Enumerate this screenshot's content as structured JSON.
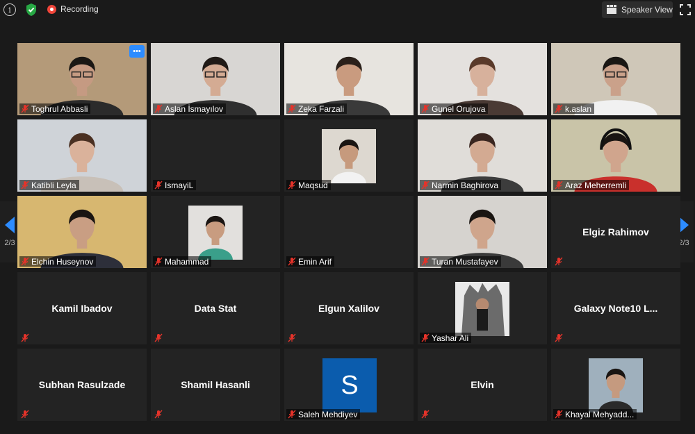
{
  "topbar": {
    "recording_label": "Recording",
    "speaker_view_label": "Speaker View"
  },
  "pagination": {
    "left_label": "2/3",
    "right_label": "2/3"
  },
  "tiles": [
    {
      "name": "Toghrul Abbasli",
      "video": true,
      "skin": "#c59a82",
      "shirt": "#2b2b2b",
      "bg": "#b49a79",
      "hair": "#1a1714",
      "glasses": true,
      "active_menu": true
    },
    {
      "name": "Aslan İsmayılov",
      "video": true,
      "skin": "#d4ab93",
      "shirt": "#2f2f2f",
      "bg": "#d8d6d3",
      "hair": "#201a16",
      "glasses": true
    },
    {
      "name": "Zeka Farzali",
      "video": true,
      "skin": "#c99b7f",
      "shirt": "#3a3a3a",
      "bg": "#e7e4df",
      "hair": "#2a201a"
    },
    {
      "name": "Gunel Orujova",
      "video": true,
      "skin": "#d7b19c",
      "shirt": "#4a3a34",
      "bg": "#e4e1de",
      "hair": "#5a3a2a"
    },
    {
      "name": "k.aslan",
      "video": true,
      "skin": "#caa18a",
      "shirt": "#f1f1f1",
      "bg": "#cfc7b8",
      "hair": "#1a1714",
      "glasses": true
    },
    {
      "name": "Katibli Leyla",
      "video": true,
      "skin": "#dab29b",
      "shirt": "#c8c0b8",
      "bg": "#cfd3d8",
      "hair": "#4a3022"
    },
    {
      "name": "IsmayiL",
      "video": false
    },
    {
      "name": "Maqsud",
      "video": true,
      "small": true,
      "skin": "#c69a7d",
      "shirt": "#f2f2f2",
      "bg": "#ddd8d0",
      "hair": "#1a1512"
    },
    {
      "name": "Narmin Baghirova",
      "video": true,
      "skin": "#d3aa92",
      "shirt": "#3c3c3c",
      "bg": "#e0ddd9",
      "hair": "#3a2620"
    },
    {
      "name": "Araz Meherremli",
      "video": true,
      "skin": "#d0a58d",
      "shirt": "#c9302c",
      "bg": "#c9c4a8",
      "hair": "#1a1512",
      "headset": true
    },
    {
      "name": "Elchin Huseynov",
      "video": true,
      "skin": "#c99e83",
      "shirt": "#2d2f3a",
      "bg": "#d7b770",
      "hair": "#1a1512"
    },
    {
      "name": "Mahammad",
      "video": true,
      "small": true,
      "skin": "#c89c80",
      "shirt": "#3a9f8a",
      "bg": "#e2e0dd",
      "hair": "#1a1512"
    },
    {
      "name": "Emin Arif",
      "video": false
    },
    {
      "name": "Turan Mustafayev",
      "video": true,
      "skin": "#cfa58c",
      "shirt": "#3a3a3a",
      "bg": "#d6d3cf",
      "hair": "#1a1512"
    },
    {
      "name": "Elgiz Rahimov",
      "video": false,
      "big": true
    },
    {
      "name": "Kamil Ibadov",
      "video": false,
      "big": true
    },
    {
      "name": "Data Stat",
      "video": false,
      "big": true
    },
    {
      "name": "Elgun Xalilov",
      "video": false,
      "big": true
    },
    {
      "name": "Yashar Ali",
      "video": true,
      "small": true,
      "throne": true,
      "skin": "#b68a70",
      "shirt": "#222",
      "bg": "#e9e9e9",
      "hair": "#1a1512"
    },
    {
      "name": "Galaxy Note10 L...",
      "video": false,
      "big": true
    },
    {
      "name": "Subhan Rasulzade",
      "video": false,
      "big": true
    },
    {
      "name": "Shamil Hasanli",
      "video": false,
      "big": true
    },
    {
      "name": "Saleh Mehdiyev",
      "video": false,
      "avatar": "S"
    },
    {
      "name": "Elvin",
      "video": false,
      "big": true
    },
    {
      "name": "Khayal Mehyadd...",
      "video": true,
      "small": true,
      "skin": "#c59a7f",
      "shirt": "#2a2a2a",
      "bg": "#9fb0bd",
      "hair": "#1a1512"
    }
  ],
  "colors": {
    "accent": "#2d8cff",
    "recording": "#f0453a",
    "mute": "#e5332a",
    "tile_bg": "#232323",
    "page_bg": "#1a1a1a"
  }
}
